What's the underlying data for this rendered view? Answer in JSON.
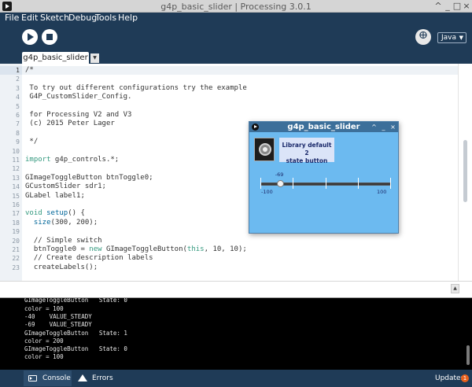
{
  "window": {
    "title": "g4p_basic_slider | Processing 3.0.1",
    "controls": [
      "^",
      "_",
      "□",
      "×"
    ]
  },
  "menu": [
    "File",
    "Edit",
    "Sketch",
    "Debug",
    "Tools",
    "Help"
  ],
  "toolbar": {
    "mode": "Java"
  },
  "tabs": [
    {
      "label": "g4p_basic_slider"
    }
  ],
  "editor": {
    "line_numbers": [
      "1",
      "2",
      "3",
      "4",
      "5",
      "6",
      "7",
      "8",
      "9",
      "10",
      "11",
      "12",
      "13",
      "14",
      "15",
      "16",
      "17",
      "18",
      "19",
      "20",
      "21",
      "22",
      "23"
    ],
    "lines": [
      "/*",
      "",
      " To try out different configurations try the example",
      " G4P_CustomSlider_Config.",
      "",
      " for Processing V2 and V3",
      " (c) 2015 Peter Lager",
      "",
      " */",
      "",
      "import g4p_controls.*;",
      "",
      "GImageToggleButton btnToggle0;",
      "GCustomSlider sdr1;",
      "GLabel label1;",
      "",
      "void setup() {",
      "  size(300, 200);",
      "",
      "  // Simple switch",
      "  btnToggle0 = new GImageToggleButton(this, 10, 10);",
      "  // Create description labels",
      "  createLabels();"
    ]
  },
  "console": {
    "lines": [
      "GImageToggleButton   State: 0",
      "color = 100",
      "-40    VALUE_STEADY",
      "-69    VALUE_STEADY",
      "GImageToggleButton   State: 1",
      "color = 200",
      "GImageToggleButton   State: 0",
      "color = 100"
    ]
  },
  "footer": {
    "console_label": "Console",
    "errors_label": "Errors",
    "updates_label": "Updates",
    "updates_count": "1"
  },
  "sketch_window": {
    "title": "g4p_basic_slider",
    "controls": [
      "^",
      "_",
      "×"
    ],
    "label_text_1": "Library default 2",
    "label_text_2": "state button",
    "slider": {
      "value": -69,
      "value_label": "-69",
      "min": -100,
      "max": 100,
      "min_label": "-100",
      "max_label": "100"
    }
  },
  "colors": {
    "chrome": "#1f3b57",
    "sketch_bg": "#6cbaf0",
    "keyword": "#33997e",
    "function": "#006699",
    "type": "#e2661a"
  }
}
